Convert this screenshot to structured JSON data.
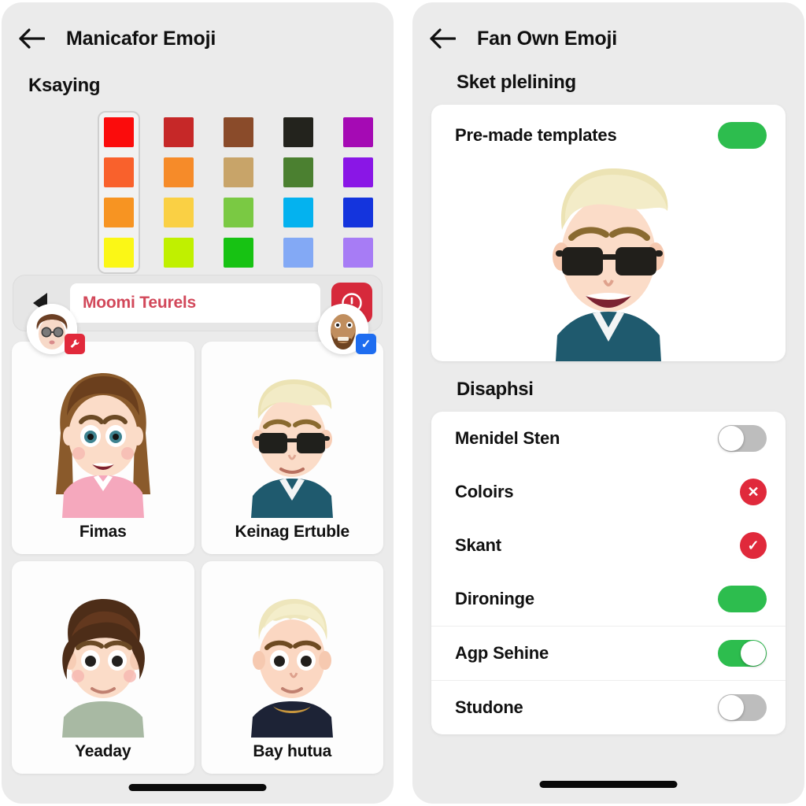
{
  "left_panel": {
    "header": {
      "back_icon": "back-arrow-icon",
      "title": "Manicafor Emoji"
    },
    "section_title": "Ksaying",
    "palette": {
      "selected_column": 0,
      "columns": [
        {
          "colors": [
            "#fb0c0c",
            "#f9612c",
            "#f79422",
            "#fbf716"
          ]
        },
        {
          "colors": [
            "#c62828",
            "#f68b29",
            "#fad044",
            "#c0f000"
          ]
        },
        {
          "colors": [
            "#8a4b2a",
            "#c8a469",
            "#7ac943",
            "#17c213"
          ]
        },
        {
          "colors": [
            "#23231d",
            "#4b8030",
            "#04b2ef",
            "#83a9f5"
          ]
        },
        {
          "colors": [
            "#a50ab4",
            "#8a16e6",
            "#1434dd",
            "#a77cf5"
          ]
        }
      ]
    },
    "avatar_left": {
      "name": "brown-hair-sunglasses-avatar",
      "badge_icon": "wrench-badge",
      "badge_color": "#e1293b"
    },
    "avatar_right": {
      "name": "bearded-face-avatar",
      "badge_icon": "check-badge",
      "badge_symbol": "✓",
      "badge_color": "#1e6df0"
    },
    "input_row": {
      "prev_icon": "triangle-left-icon",
      "value": "Moomi Teurels",
      "placeholder": "Moomi Teurels",
      "alert_icon": "exclamation-circle-icon"
    },
    "cards": [
      {
        "label": "Fimas",
        "art": "girl-brown-long-hair"
      },
      {
        "label": "Keinag Ertuble",
        "art": "boy-blond-sunglasses"
      },
      {
        "label": "Yeaday",
        "art": "girl-short-brown-hair"
      },
      {
        "label": "Bay hutua",
        "art": "boy-blond-short"
      }
    ]
  },
  "right_panel": {
    "header": {
      "back_icon": "back-arrow-icon",
      "title": "Fan Own Emoji"
    },
    "section_title": "Sket plelining",
    "template_card": {
      "title": "Pre-made templates",
      "toggle": {
        "state": "on",
        "style": "plain",
        "color": "#2dbd4e"
      },
      "art": "boy-blond-sunglasses-smiling"
    },
    "settings_title": "Disaphsi",
    "settings": [
      {
        "label": "Menidel Sten",
        "control": "toggle",
        "state": "off",
        "style": "knob",
        "color": "#bdbdbd"
      },
      {
        "label": "Coloirs",
        "control": "status",
        "state": "cross",
        "symbol": "✕",
        "color": "#e0293b"
      },
      {
        "label": "Skant",
        "control": "status",
        "state": "check",
        "symbol": "✓",
        "color": "#e0293b"
      },
      {
        "label": "Dironinge",
        "control": "toggle",
        "state": "on",
        "style": "plain",
        "color": "#2dbd4e"
      },
      {
        "label": "Agp Sehine",
        "control": "toggle",
        "state": "on",
        "style": "knob",
        "color": "#2dbd4e"
      },
      {
        "label": "Studone",
        "control": "toggle",
        "state": "off",
        "style": "knob",
        "color": "#bdbdbd"
      }
    ]
  }
}
